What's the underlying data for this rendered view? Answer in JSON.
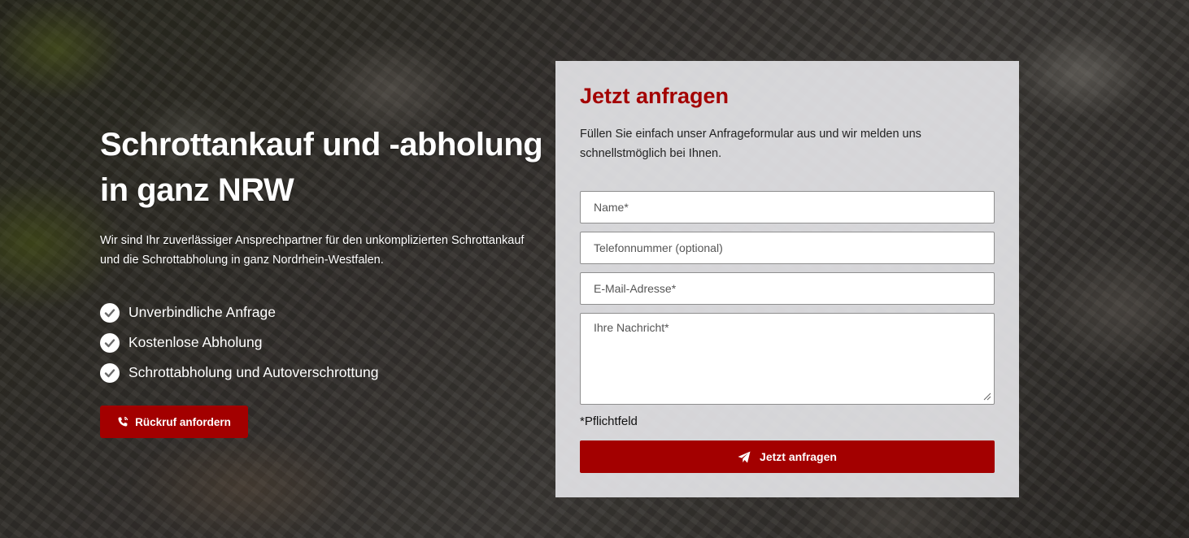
{
  "hero": {
    "title_line1": "Schrottankauf und -abholung",
    "title_line2": "in ganz NRW",
    "subtitle": "Wir sind Ihr zuverlässiger Ansprechpartner für den unkomplizierten Schrottankauf und die Schrottabholung in ganz Nordrhein-Westfalen.",
    "features": [
      "Unverbindliche Anfrage",
      "Kostenlose Abholung",
      "Schrottabholung und Autoverschrottung"
    ],
    "callback_label": "Rückruf anfordern",
    "callback_icon": "phone-icon"
  },
  "form": {
    "title": "Jetzt anfragen",
    "intro": "Füllen Sie einfach unser Anfrageformular aus und wir melden uns schnellstmöglich bei Ihnen.",
    "name_placeholder": "Name*",
    "phone_placeholder": "Telefonnummer (optional)",
    "email_placeholder": "E-Mail-Adresse*",
    "message_placeholder": "Ihre Nachricht*",
    "required_note": "*Pflichtfeld",
    "submit_label": "Jetzt anfragen",
    "submit_icon": "paper-plane-icon"
  },
  "colors": {
    "accent": "#a30000",
    "panel_bg": "#e8e8eb"
  }
}
